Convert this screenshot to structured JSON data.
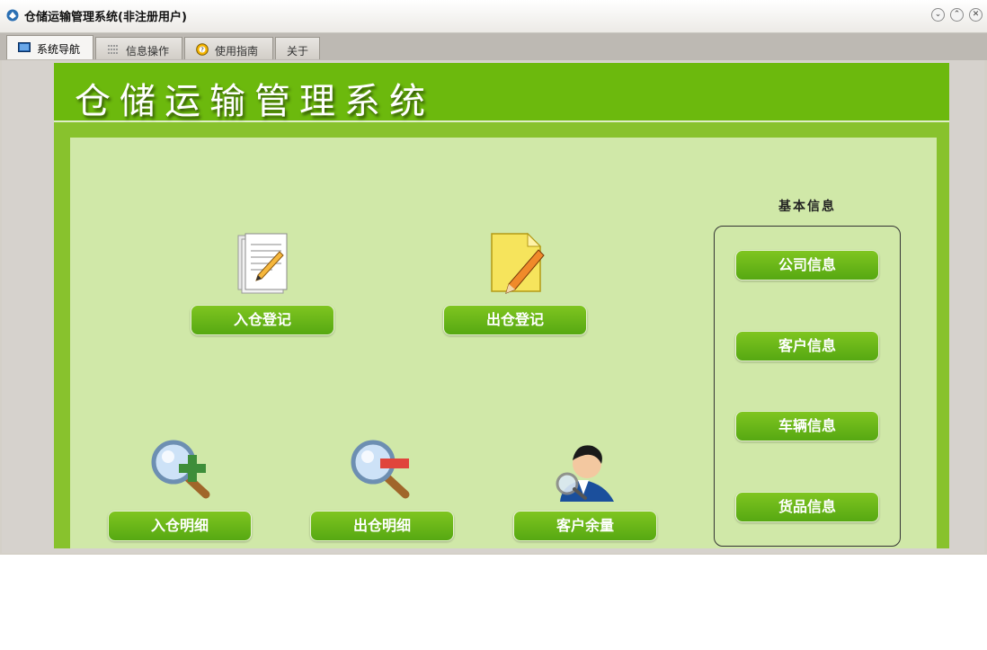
{
  "window": {
    "title": "仓储运输管理系统(非注册用户)",
    "controls": [
      "minimize",
      "restore",
      "close"
    ]
  },
  "tabs": [
    {
      "label": "系统导航",
      "icon": "monitor-icon",
      "active": true
    },
    {
      "label": "信息操作",
      "icon": "grid-icon",
      "active": false
    },
    {
      "label": "使用指南",
      "icon": "help-icon",
      "active": false
    },
    {
      "label": "关于",
      "icon": "",
      "active": false
    }
  ],
  "header": {
    "title": "仓储运输管理系统"
  },
  "actions": {
    "inbound_register": "入仓登记",
    "outbound_register": "出仓登记",
    "inbound_detail": "入仓明细",
    "outbound_detail": "出仓明细",
    "customer_balance": "客户余量"
  },
  "basic_info": {
    "title": "基本信息",
    "company": "公司信息",
    "customer": "客户信息",
    "vehicle": "车辆信息",
    "goods": "货品信息"
  },
  "colors": {
    "header_green": "#6cb90d",
    "panel_green": "#88c22d",
    "body_green": "#d0e8a8",
    "button_green": "#56a812"
  }
}
